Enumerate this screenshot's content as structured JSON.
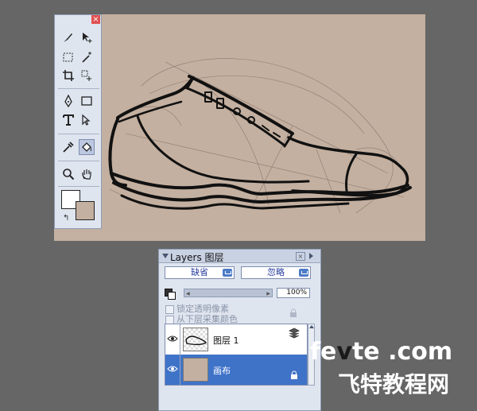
{
  "layers_panel": {
    "title": "Layers 图层",
    "blend_mode": "缺省",
    "ignore_option": "忽略",
    "opacity": "100%",
    "opacity_slider_left": "◀",
    "opacity_slider_right": "▶",
    "lock_transparency_label": "锁定透明像素",
    "sample_below_label": "从下层采集颜色",
    "layers": [
      {
        "name": "图层 1",
        "visible": true,
        "selected": false
      },
      {
        "name": "画布",
        "visible": true,
        "selected": true
      }
    ]
  },
  "toolbox": {
    "close": "×",
    "tools": [
      "brush-tool",
      "move-tool",
      "rect-select-tool",
      "magic-wand-tool",
      "crop-tool",
      "transform-tool",
      "pen-tool",
      "shape-tool",
      "text-tool",
      "direct-select-tool",
      "eyedropper-tool",
      "paint-bucket-tool",
      "zoom-tool",
      "hand-tool"
    ],
    "foreground_color": "#ffffff",
    "background_color": "#c4b0a0"
  },
  "canvas": {
    "background_color": "#c4b0a0"
  },
  "watermark": {
    "line1_pre": "fe",
    "line1_v": "v",
    "line1_post": "te .com",
    "line2": "飞特教程网"
  }
}
